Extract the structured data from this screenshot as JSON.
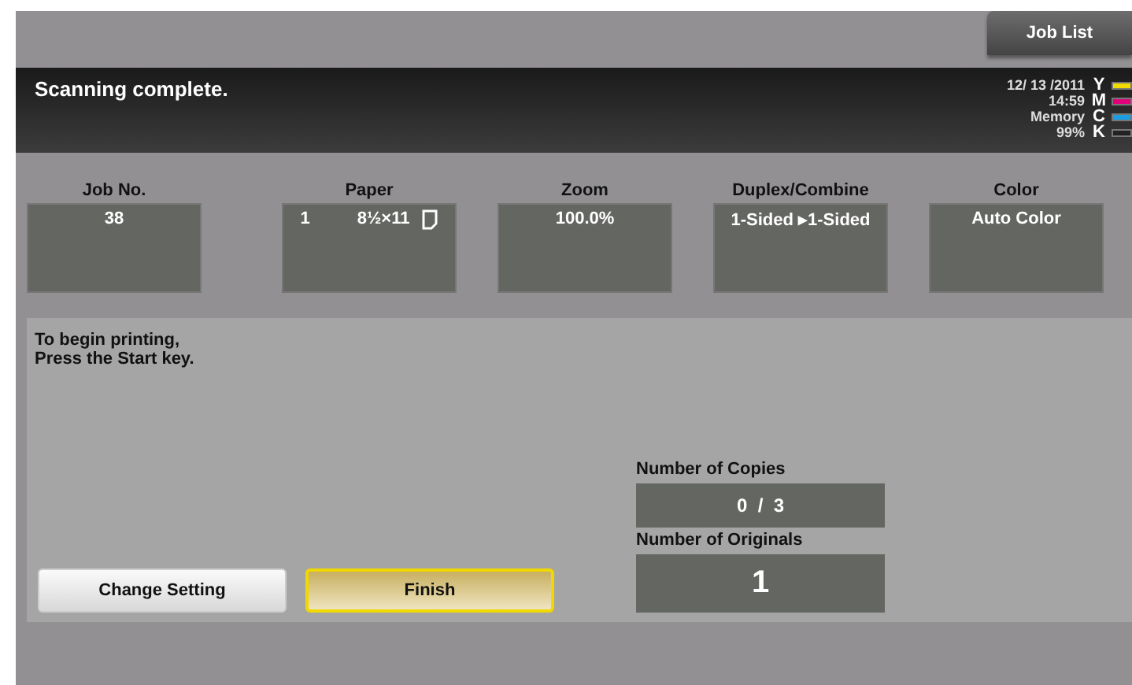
{
  "job_list_button": "Job List",
  "message": "Scanning complete.",
  "status": {
    "date": "12/ 13 /2011",
    "time": "14:59",
    "memory_label": "Memory",
    "memory": "99%"
  },
  "toners": [
    {
      "letter": "Y",
      "color": "#f2dc00",
      "level": 1
    },
    {
      "letter": "M",
      "color": "#e0007a",
      "level": 1
    },
    {
      "letter": "C",
      "color": "#1a9ee0",
      "level": 1
    },
    {
      "letter": "K",
      "color": "#222222",
      "level": 0
    }
  ],
  "settings": [
    {
      "label": "Job No.",
      "value": "38"
    },
    {
      "label": "Paper",
      "tray": "1",
      "value": "8½×11"
    },
    {
      "label": "Zoom",
      "value": "100.0%"
    },
    {
      "label": "Duplex/Combine",
      "value": "1-Sided ▸1-Sided"
    },
    {
      "label": "Color",
      "value": "Auto Color"
    }
  ],
  "instruction": "To begin printing,\nPress the Start key.",
  "copies": {
    "label": "Number of Copies",
    "value": "0  /  3"
  },
  "originals": {
    "label": "Number of Originals",
    "value": "1"
  },
  "buttons": [
    {
      "label": "Change Setting",
      "kind": "plain"
    },
    {
      "label": "Finish",
      "kind": "highlight"
    }
  ]
}
